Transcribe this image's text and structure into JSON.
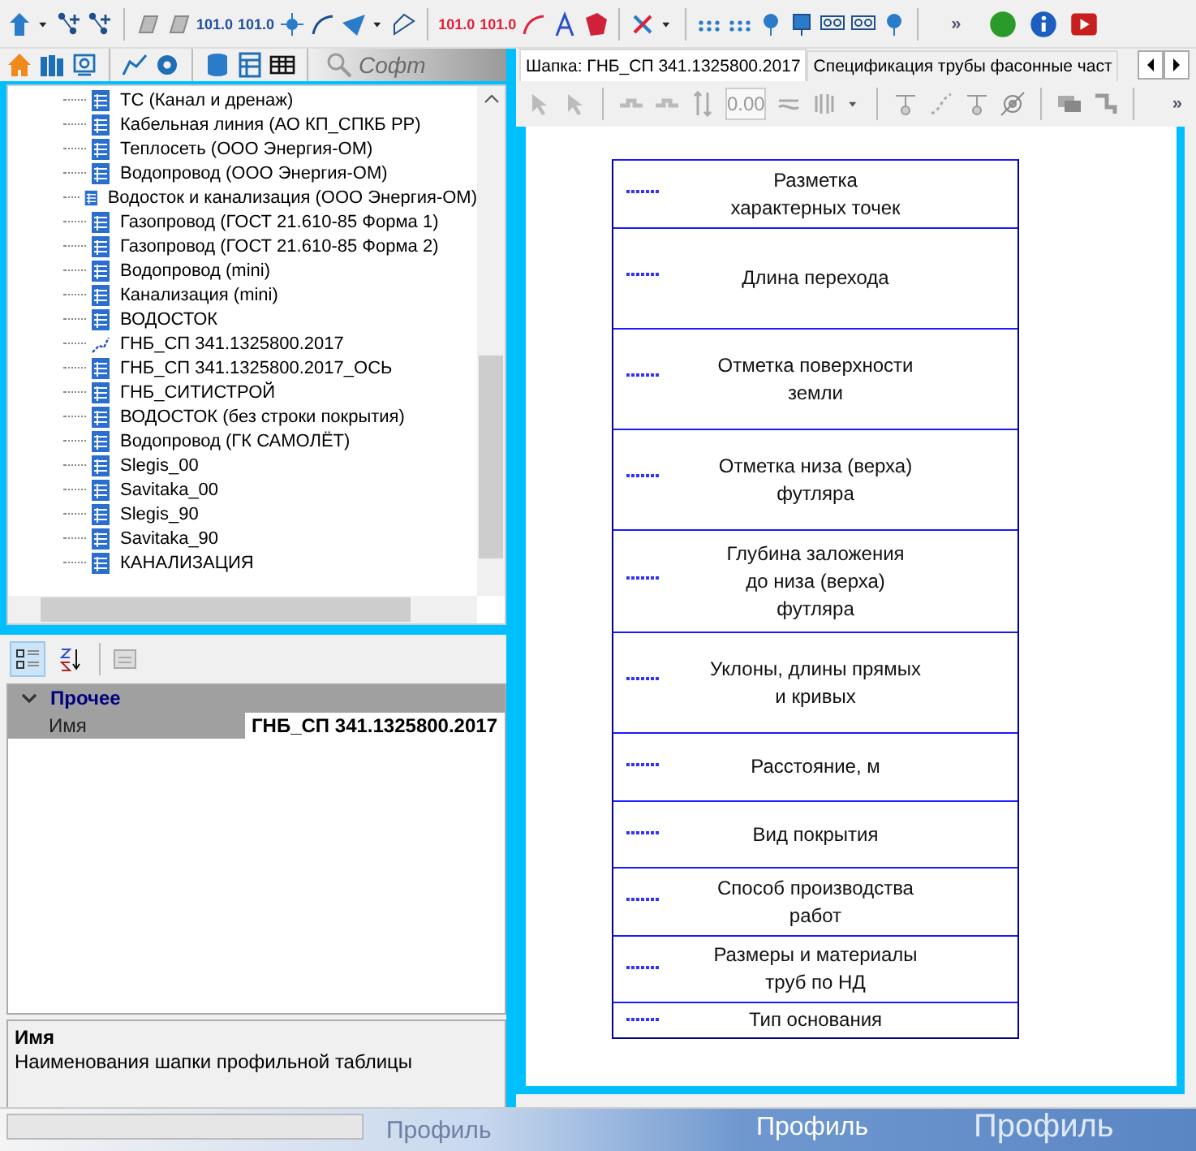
{
  "main_toolbar": {
    "point_buttons": [
      {
        "text": "101.0",
        "color": "#1f4f9a"
      },
      {
        "text": "101.0",
        "color": "#1f4f9a"
      },
      {
        "text": "101.0",
        "color": "#e0203a"
      },
      {
        "text": "101.0",
        "color": "#e0203a"
      }
    ],
    "overflow": "»"
  },
  "left_toolbar": {
    "search_placeholder": "Софт"
  },
  "tree": {
    "items": [
      {
        "label": "ТС (Канал и дренаж)",
        "kind": "table"
      },
      {
        "label": "Кабельная линия (АО КП_СПКБ РР)",
        "kind": "table"
      },
      {
        "label": "Теплосеть (ООО Энергия-ОМ)",
        "kind": "table"
      },
      {
        "label": "Водопровод (ООО Энергия-ОМ)",
        "kind": "table"
      },
      {
        "label": "Водосток и канализация (ООО Энергия-ОМ)",
        "kind": "table"
      },
      {
        "label": "Газопровод (ГОСТ 21.610-85 Форма 1)",
        "kind": "table"
      },
      {
        "label": "Газопровод (ГОСТ 21.610-85 Форма 2)",
        "kind": "table"
      },
      {
        "label": "Водопровод (mini)",
        "kind": "table"
      },
      {
        "label": "Канализация (mini)",
        "kind": "table"
      },
      {
        "label": "ВОДОСТОК",
        "kind": "table"
      },
      {
        "label": "ГНБ_СП 341.1325800.2017",
        "kind": "line"
      },
      {
        "label": "ГНБ_СП 341.1325800.2017_ОСЬ",
        "kind": "table"
      },
      {
        "label": "ГНБ_СИТИСТРОЙ",
        "kind": "table"
      },
      {
        "label": "ВОДОСТОК (без строки покрытия)",
        "kind": "table"
      },
      {
        "label": "Водопровод (ГК САМОЛЁТ)",
        "kind": "table"
      },
      {
        "label": "Slegis_00",
        "kind": "table"
      },
      {
        "label": "Savitaka_00",
        "kind": "table"
      },
      {
        "label": "Slegis_90",
        "kind": "table"
      },
      {
        "label": "Savitaka_90",
        "kind": "table"
      },
      {
        "label": "КАНАЛИЗАЦИЯ",
        "kind": "table"
      }
    ]
  },
  "properties": {
    "sort_buttons": [
      {
        "selected": true
      },
      {
        "selected": false
      }
    ],
    "category": {
      "label": "Прочее",
      "expanded": true
    },
    "rows": [
      {
        "name": "Имя",
        "value": "ГНБ_СП 341.1325800.2017"
      }
    ],
    "description": {
      "title": "Имя",
      "text": "Наименования шапки профильной таблицы"
    }
  },
  "tabs": [
    {
      "label": "Шапка: ГНБ_СП 341.1325800.2017",
      "selected": true
    },
    {
      "label": "Спецификация трубы фасонные част",
      "selected": false
    }
  ],
  "editor_toolbar": {
    "value": "0.00",
    "overflow": "»"
  },
  "header_table": {
    "rows": [
      {
        "lines": [
          "Разметка",
          "характерных точек"
        ]
      },
      {
        "lines": [
          "Длина перехода"
        ]
      },
      {
        "lines": [
          "Отметка поверхности",
          "земли"
        ]
      },
      {
        "lines": [
          "Отметка низа (верха)",
          "футляра"
        ]
      },
      {
        "lines": [
          "Глубина заложения",
          "до низа (верха)",
          "футляра"
        ]
      },
      {
        "lines": [
          "Уклоны, длины прямых",
          "и кривых"
        ]
      },
      {
        "lines": [
          "Расстояние, м"
        ]
      },
      {
        "lines": [
          "Вид покрытия"
        ]
      },
      {
        "lines": [
          "Способ производства",
          "работ"
        ]
      },
      {
        "lines": [
          "Размеры и материалы",
          "труб по НД"
        ]
      },
      {
        "lines": [
          "Тип основания"
        ]
      }
    ]
  },
  "bottom_bar": {
    "labels": [
      "Профиль",
      "Профиль",
      "Профиль"
    ]
  }
}
